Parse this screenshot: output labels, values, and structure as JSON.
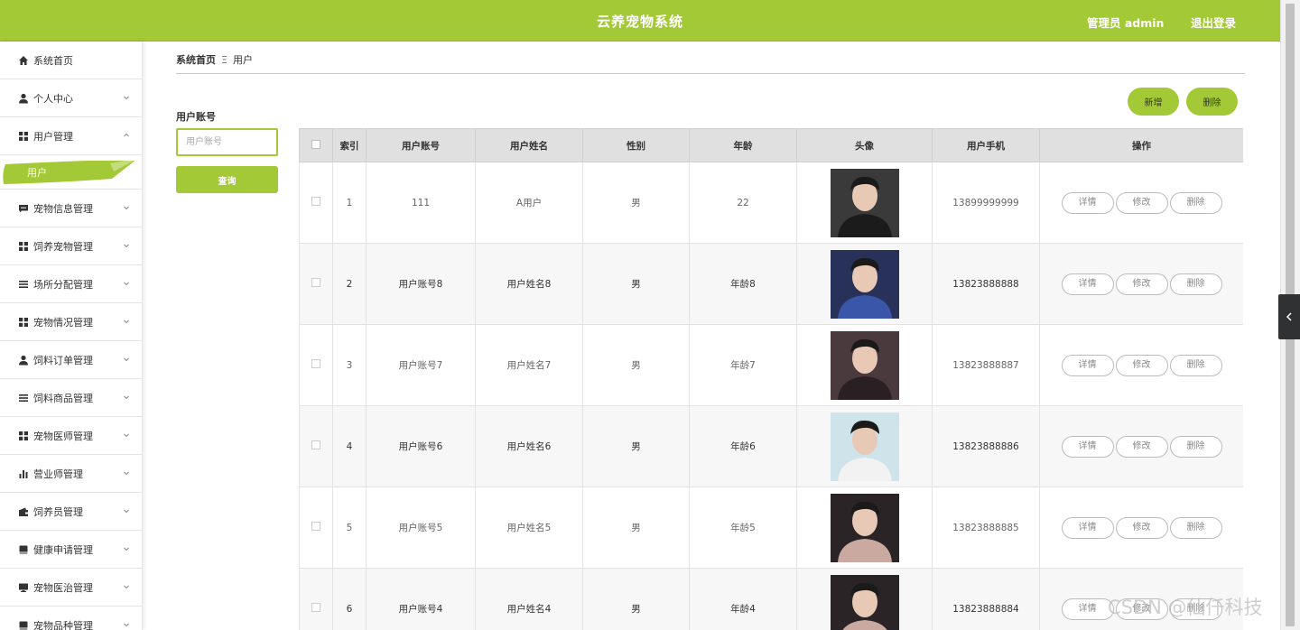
{
  "header": {
    "title": "云养宠物系统",
    "admin_label": "管理员 admin",
    "logout_label": "退出登录"
  },
  "sidebar": {
    "items": [
      {
        "label": "系统首页",
        "icon": "home-icon",
        "expandable": false
      },
      {
        "label": "个人中心",
        "icon": "user-icon",
        "expandable": true
      },
      {
        "label": "用户管理",
        "icon": "grid-icon",
        "expandable": true,
        "expanded": true
      },
      {
        "label": "宠物信息管理",
        "icon": "comment-icon",
        "expandable": true
      },
      {
        "label": "饲养宠物管理",
        "icon": "grid-icon",
        "expandable": true
      },
      {
        "label": "场所分配管理",
        "icon": "list-icon",
        "expandable": true
      },
      {
        "label": "宠物情况管理",
        "icon": "grid-icon",
        "expandable": true
      },
      {
        "label": "饲料订单管理",
        "icon": "user-icon",
        "expandable": true
      },
      {
        "label": "饲料商品管理",
        "icon": "list-icon",
        "expandable": true
      },
      {
        "label": "宠物医师管理",
        "icon": "grid-icon",
        "expandable": true
      },
      {
        "label": "营业师管理",
        "icon": "bar-chart-icon",
        "expandable": true
      },
      {
        "label": "饲养员管理",
        "icon": "wallet-icon",
        "expandable": true
      },
      {
        "label": "健康申请管理",
        "icon": "book-icon",
        "expandable": true
      },
      {
        "label": "宠物医治管理",
        "icon": "monitor-icon",
        "expandable": true
      },
      {
        "label": "宠物品种管理",
        "icon": "book-icon",
        "expandable": true
      }
    ],
    "submenu_active": "用户"
  },
  "breadcrumb": {
    "home": "系统首页",
    "separator": "Ξ",
    "current": "用户"
  },
  "search": {
    "label": "用户账号",
    "placeholder": "用户账号",
    "value": "",
    "button_label": "查询"
  },
  "toolbar": {
    "add_label": "新增",
    "delete_label": "删除"
  },
  "table": {
    "columns": [
      "",
      "索引",
      "用户账号",
      "用户姓名",
      "性别",
      "年龄",
      "头像",
      "用户手机",
      "操作"
    ],
    "rows": [
      {
        "index": "1",
        "account": "111",
        "name": "A用户",
        "gender": "男",
        "age": "22",
        "phone": "13899999999",
        "avatar_bg": "#3a3a3a",
        "avatar_fg": "#1b1b1b"
      },
      {
        "index": "2",
        "account": "用户账号8",
        "name": "用户姓名8",
        "gender": "男",
        "age": "年龄8",
        "phone": "13823888888",
        "avatar_bg": "#27315a",
        "avatar_fg": "#3a56a8"
      },
      {
        "index": "3",
        "account": "用户账号7",
        "name": "用户姓名7",
        "gender": "男",
        "age": "年龄7",
        "phone": "13823888887",
        "avatar_bg": "#4a3a3e",
        "avatar_fg": "#2a1f22"
      },
      {
        "index": "4",
        "account": "用户账号6",
        "name": "用户姓名6",
        "gender": "男",
        "age": "年龄6",
        "phone": "13823888886",
        "avatar_bg": "#cfe3ea",
        "avatar_fg": "#f2f2f2"
      },
      {
        "index": "5",
        "account": "用户账号5",
        "name": "用户姓名5",
        "gender": "男",
        "age": "年龄5",
        "phone": "13823888885",
        "avatar_bg": "#2b2426",
        "avatar_fg": "#c9a9a0"
      },
      {
        "index": "6",
        "account": "用户账号4",
        "name": "用户姓名4",
        "gender": "男",
        "age": "年龄4",
        "phone": "13823888884",
        "avatar_bg": "#2b2426",
        "avatar_fg": "#c9a9a0"
      }
    ],
    "actions": {
      "detail": "详情",
      "edit": "修改",
      "delete": "删除"
    }
  },
  "watermark": "CSDN @仙仟科技",
  "colors": {
    "accent": "#a3c936",
    "toggle": "#2f3133"
  }
}
